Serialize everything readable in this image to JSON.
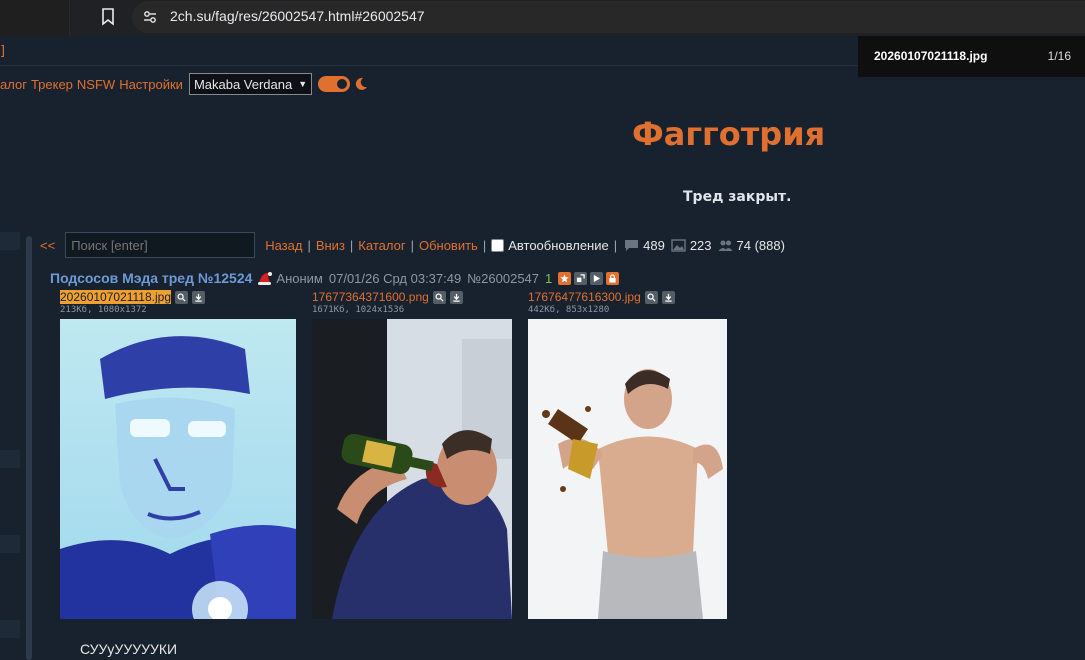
{
  "browser": {
    "url": "2ch.su/fag/res/26002547.html#26002547"
  },
  "page": {
    "bracket": "]",
    "menu": [
      "алог",
      "Трекер",
      "NSFW",
      "Настройки"
    ],
    "style_select": "Makaba Verdana",
    "board_title": "Фагготрия",
    "closed_text": "Тред закрыт."
  },
  "controls": {
    "back_arrows": "<<",
    "search_placeholder": "Поиск [enter]",
    "links": [
      "Назад",
      "Вниз",
      "Каталог",
      "Обновить"
    ],
    "autoupdate": "Автообновление",
    "posts": "489",
    "images": "223",
    "posters": "74 (888)"
  },
  "post": {
    "subject": "Подсосов Мэда тред №12524",
    "name": "Аноним",
    "date": "07/01/26 Срд 03:37:49",
    "num": "№26002547",
    "replies": "1",
    "text": "СУУуУУУУУКИ",
    "files": [
      {
        "name": "20260107021118.jpg",
        "info": "213Кб, 1080x1372"
      },
      {
        "name": "17677364371600.png",
        "info": "1671Кб, 1024x1536"
      },
      {
        "name": "17676477616300.jpg",
        "info": "442Кб, 853x1280"
      }
    ]
  },
  "viewer": {
    "filename": "20260107021118.jpg",
    "counter": "1/16"
  },
  "colors": {
    "accent": "#e07030",
    "subject": "#6d9ad5",
    "background": "#18222e"
  }
}
